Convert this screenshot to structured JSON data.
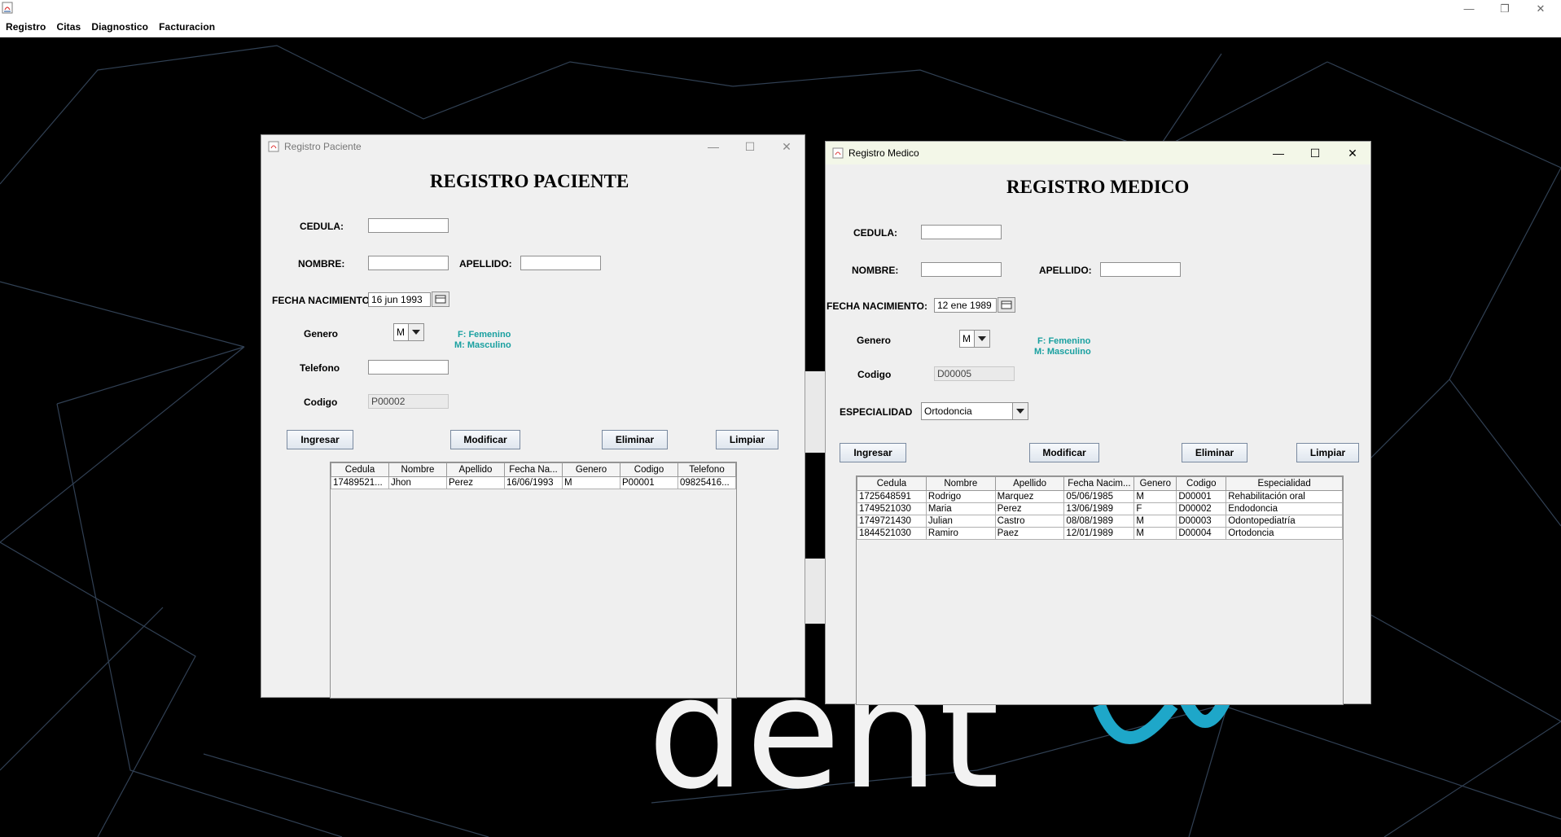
{
  "app": {
    "menu": [
      "Registro",
      "Citas",
      "Diagnostico",
      "Facturacion"
    ],
    "controls": {
      "minimize": "—",
      "maximize": "❐",
      "close": "✕"
    },
    "background_text": "dent"
  },
  "paciente": {
    "window_title": "Registro Paciente",
    "heading": "REGISTRO PACIENTE",
    "labels": {
      "cedula": "CEDULA:",
      "nombre": "NOMBRE:",
      "apellido": "APELLIDO:",
      "fecha": "FECHA  NACIMIENTO:",
      "genero": "Genero",
      "telefono": "Telefono",
      "codigo": "Codigo"
    },
    "values": {
      "cedula": "",
      "nombre": "",
      "apellido": "",
      "fecha": "16 jun 1993",
      "genero": "M",
      "telefono": "",
      "codigo": "P00002"
    },
    "hint": {
      "f": "F: Femenino",
      "m": "M: Masculino"
    },
    "buttons": {
      "ingresar": "Ingresar",
      "modificar": "Modificar",
      "eliminar": "Eliminar",
      "limpiar": "Limpiar"
    },
    "table": {
      "columns": [
        "Cedula",
        "Nombre",
        "Apellido",
        "Fecha Na...",
        "Genero",
        "Codigo",
        "Telefono"
      ],
      "rows": [
        [
          "17489521...",
          "Jhon",
          "Perez",
          "16/06/1993",
          "M",
          "P00001",
          "09825416..."
        ]
      ]
    }
  },
  "medico": {
    "window_title": "Registro Medico",
    "heading": "REGISTRO MEDICO",
    "labels": {
      "cedula": "CEDULA:",
      "nombre": "NOMBRE:",
      "apellido": "APELLIDO:",
      "fecha": "FECHA  NACIMIENTO:",
      "genero": "Genero",
      "codigo": "Codigo",
      "especialidad": "ESPECIALIDAD"
    },
    "values": {
      "cedula": "",
      "nombre": "",
      "apellido": "",
      "fecha": "12 ene 1989",
      "genero": "M",
      "codigo": "D00005",
      "especialidad": "Ortodoncia"
    },
    "hint": {
      "f": "F: Femenino",
      "m": "M: Masculino"
    },
    "buttons": {
      "ingresar": "Ingresar",
      "modificar": "Modificar",
      "eliminar": "Eliminar",
      "limpiar": "Limpiar"
    },
    "table": {
      "columns": [
        "Cedula",
        "Nombre",
        "Apellido",
        "Fecha Nacim...",
        "Genero",
        "Codigo",
        "Especialidad"
      ],
      "rows": [
        [
          "1725648591",
          "Rodrigo",
          "Marquez",
          "05/06/1985",
          "M",
          "D00001",
          "Rehabilitación oral"
        ],
        [
          "1749521030",
          "Maria",
          "Perez",
          "13/06/1989",
          "F",
          "D00002",
          "Endodoncia"
        ],
        [
          "1749721430",
          "Julian",
          "Castro",
          "08/08/1989",
          "M",
          "D00003",
          "Odontopediatría"
        ],
        [
          "1844521030",
          "Ramiro",
          "Paez",
          "12/01/1989",
          "M",
          "D00004",
          "Ortodoncia"
        ]
      ]
    }
  }
}
